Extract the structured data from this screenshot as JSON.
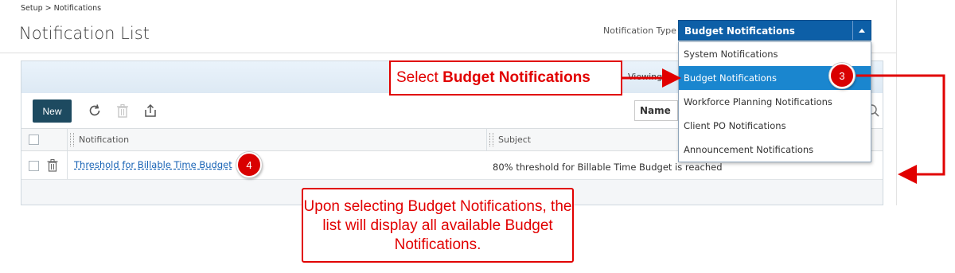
{
  "breadcrumb": "Setup > Notifications",
  "page_title": "Notification List",
  "notification_type": {
    "label": "Notification Type",
    "selected": "Budget Notifications",
    "options": [
      "System Notifications",
      "Budget Notifications",
      "Workforce Planning Notifications",
      "Client PO Notifications",
      "Announcement Notifications"
    ]
  },
  "panel": {
    "viewing_label": "Viewing"
  },
  "toolbar": {
    "new_label": "New",
    "sort_label": "Name"
  },
  "table": {
    "columns": [
      "Notification",
      "Subject"
    ],
    "rows": [
      {
        "notification": "Threshold for Billable Time Budget",
        "subject": "80% threshold for Billable Time Budget is reached"
      }
    ]
  },
  "annotations": {
    "callout_select_prefix": "Select ",
    "callout_select_bold": "Budget Notifications",
    "callout_info": "Upon selecting Budget Notifications, the list will display all available Budget Notifications.",
    "step_3": "3",
    "step_4": "4",
    "color": "#e10000"
  },
  "colors": {
    "select_bg": "#0d5fa7",
    "selected_option": "#1a86cf",
    "new_button": "#1d4a60",
    "link": "#1863b5"
  }
}
